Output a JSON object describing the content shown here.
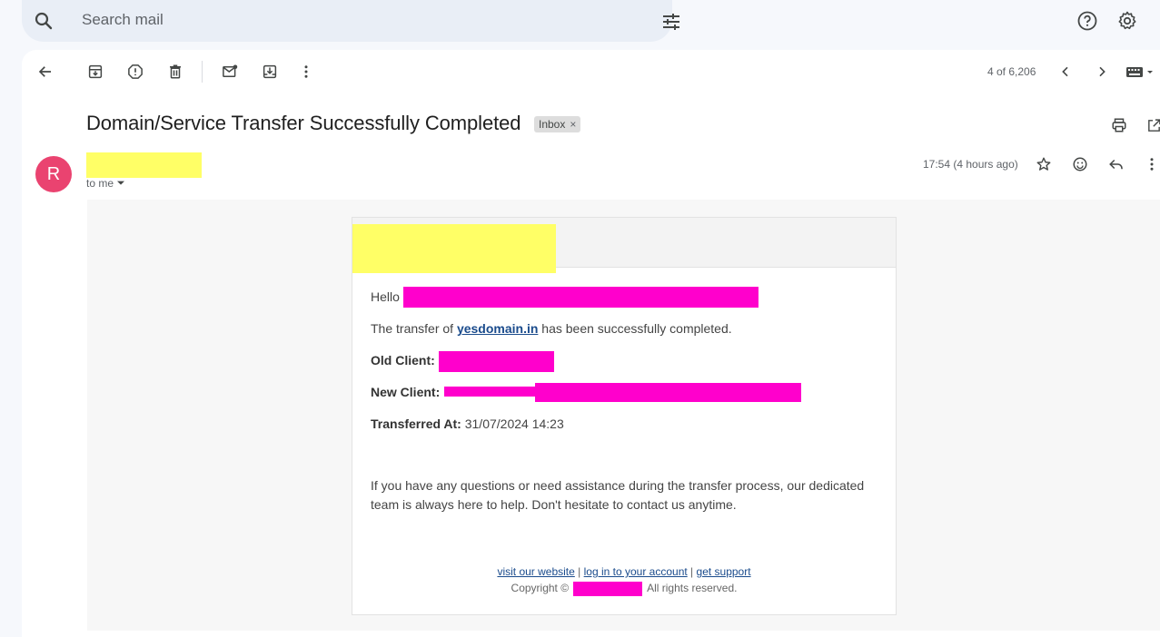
{
  "search": {
    "placeholder": "Search mail"
  },
  "toolbar": {
    "counter": "4 of 6,206"
  },
  "email": {
    "subject": "Domain/Service Transfer Successfully Completed",
    "label": "Inbox",
    "label_close": "×",
    "avatar_letter": "R",
    "to": "to me",
    "timestamp": "17:54 (4 hours ago)",
    "body": {
      "hello": "Hello",
      "transfer_prefix": "The transfer of",
      "domain": "yesdomain.in",
      "transfer_suffix": "has been successfully completed.",
      "old_client_label": "Old Client:",
      "new_client_label": "New Client:",
      "transferred_at_label": "Transferred At:",
      "transferred_at_value": "31/07/2024 14:23",
      "paragraph": "If you have any questions or need assistance during the transfer process, our dedicated team is always here to help. Don't hesitate to contact us anytime.",
      "footer_link_1": "visit our website",
      "footer_link_2": "log in to your account",
      "footer_link_3": "get support",
      "separator": "|",
      "copyright_prefix": "Copyright ©",
      "copyright_suffix": "All rights reserved."
    }
  },
  "colors": {
    "avatar": "#ea4370",
    "redaction_yellow": "#ffff66",
    "redaction_pink": "#ff00cc",
    "link": "#1a4b8c"
  },
  "icons": [
    "search-icon",
    "tune-icon",
    "help-icon",
    "settings-icon",
    "back-icon",
    "archive-icon",
    "report-spam-icon",
    "delete-icon",
    "mark-unread-icon",
    "move-to-icon",
    "more-vert-icon",
    "chevron-left-icon",
    "chevron-right-icon",
    "keyboard-icon",
    "print-icon",
    "open-in-new-icon",
    "star-icon",
    "emoji-icon",
    "reply-icon"
  ]
}
